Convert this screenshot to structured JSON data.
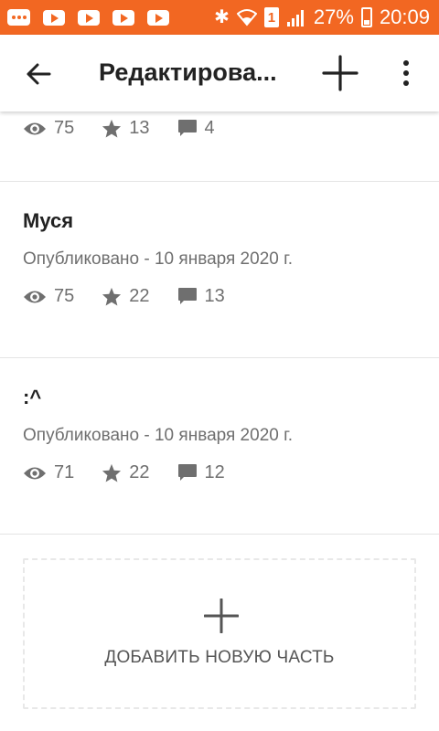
{
  "status_bar": {
    "battery_percent": "27%",
    "time": "20:09",
    "sim_label": "1"
  },
  "app_bar": {
    "title": "Редактирова..."
  },
  "parts": [
    {
      "title": "",
      "date": "",
      "views": "75",
      "stars": "13",
      "comments": "4"
    },
    {
      "title": "Муся",
      "date": "Опубликовано - 10 января 2020 г.",
      "views": "75",
      "stars": "22",
      "comments": "13"
    },
    {
      "title": ":^",
      "date": "Опубликовано - 10 января 2020 г.",
      "views": "71",
      "stars": "22",
      "comments": "12"
    }
  ],
  "add_part": {
    "label": "ДОБАВИТЬ НОВУЮ ЧАСТЬ"
  },
  "colors": {
    "status_bar": "#f26722",
    "meta_text": "#6f6f6f",
    "icon": "#6f6f6f"
  }
}
